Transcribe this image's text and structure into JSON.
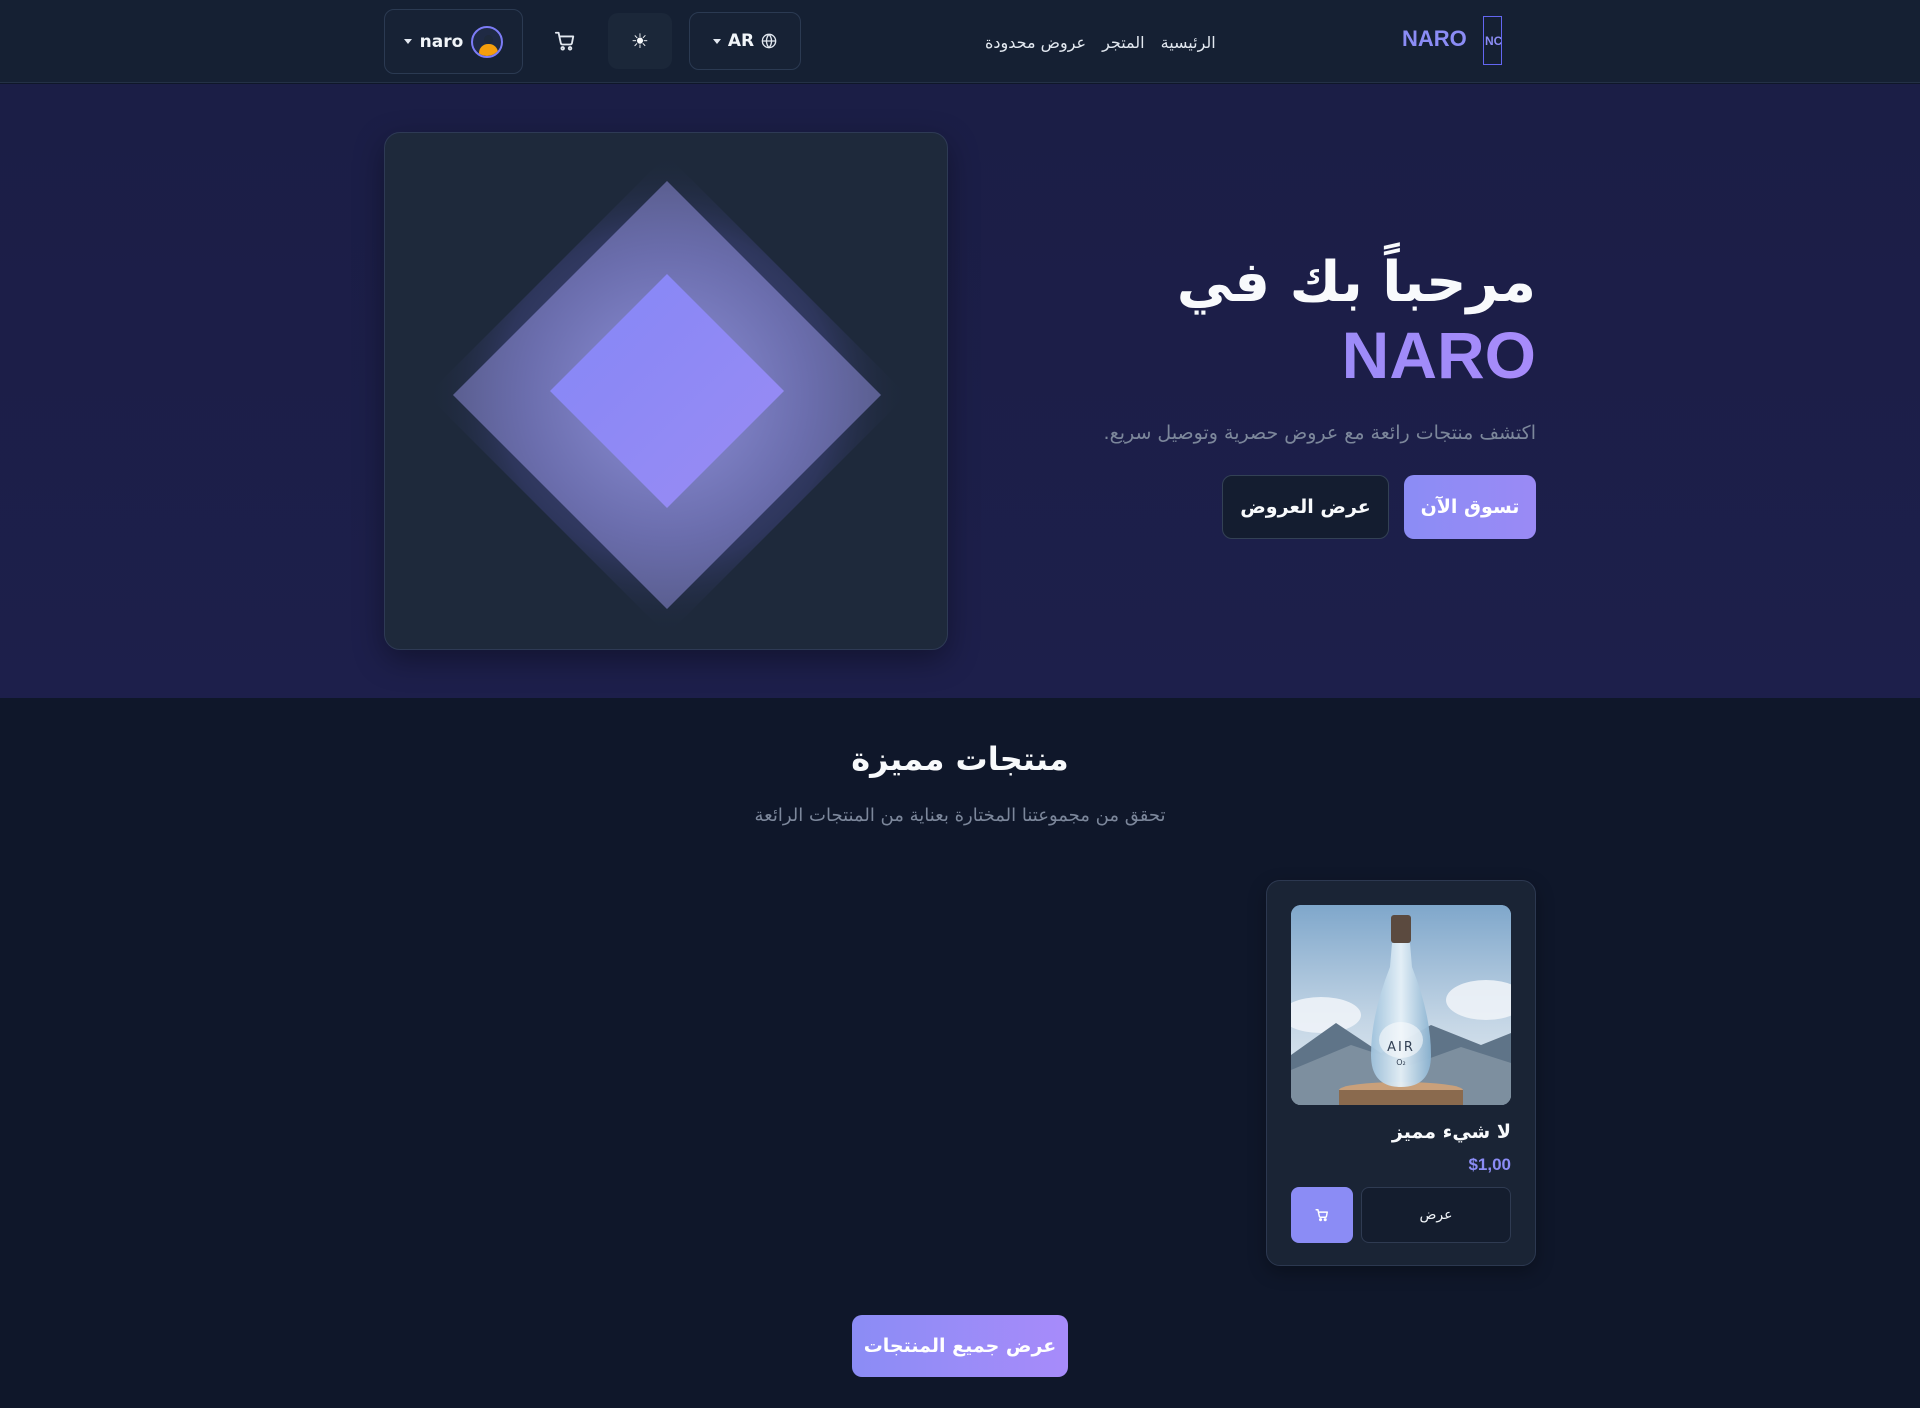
{
  "header": {
    "brand": "NARO",
    "brand_logo": "NC",
    "nav": [
      {
        "label": "الرئيسية"
      },
      {
        "label": "المتجر"
      },
      {
        "label": "عروض محدودة"
      }
    ],
    "language": "AR",
    "theme_icon": "sun-icon",
    "cart_icon": "cart-icon",
    "user": {
      "name": "naro",
      "avatar_icon": "avatar-icon"
    }
  },
  "hero": {
    "title": "مرحباً بك في",
    "title_accent": "NARO",
    "subtitle": "اكتشف منتجات رائعة مع عروض حصرية وتوصيل سريع.",
    "primary_button": "تسوق الآن",
    "secondary_button": "عرض العروض"
  },
  "featured": {
    "title": "منتجات مميزة",
    "subtitle": "تحقق من مجموعتنا المختارة بعناية من المنتجات الرائعة",
    "products": [
      {
        "name": "لا شيء مميز",
        "price": "$1,00",
        "view_label": "عرض",
        "image_label": "AIR",
        "image_sublabel": "O₂"
      }
    ],
    "view_all_button": "عرض جميع المنتجات"
  },
  "colors": {
    "accent": "#8b8cf5",
    "background": "#0f172a",
    "hero_background": "#1c1f48",
    "card": "#1e293b"
  }
}
